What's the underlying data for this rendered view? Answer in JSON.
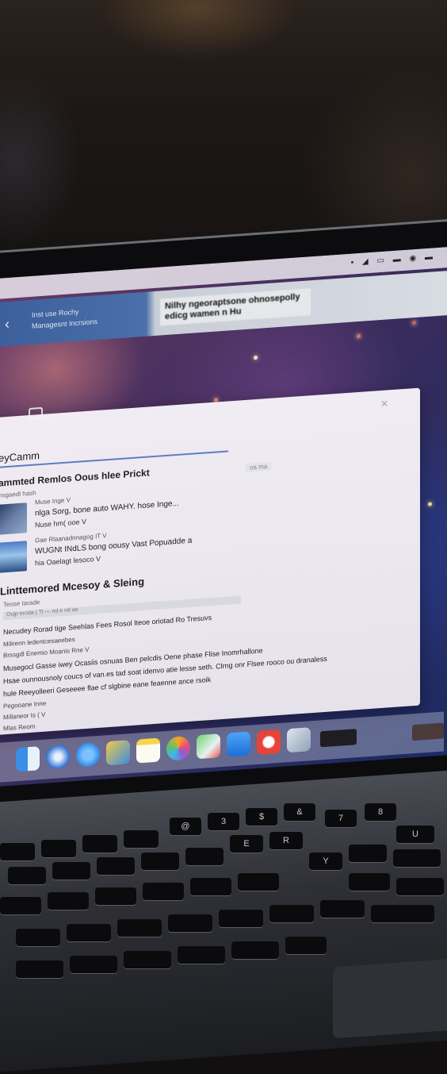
{
  "app": {
    "line1": "Inst use Rochy",
    "line2": "Managesnt Incrsions",
    "heading": "Nilhy ngeoraptsone ohnosepolly edicg wamen n Hu"
  },
  "panel": {
    "title": "eyCamm",
    "section1": "ammted Remlos Oous hlee Prickt",
    "section1_sub": "hsgaedl hash",
    "meta_tag": "oa  ma",
    "items": [
      {
        "meta": "Muse Inge  V",
        "title": "nlga Sorg, bone auto WAHY. hose Inge...",
        "sub": "Nuse hm( ooe  V"
      },
      {
        "meta": "Gae Rlaanadnnagog IT  V",
        "title": "WUGNt  INdLS bong oousy Vast Popuadde a",
        "sub": "hia Oaelagt lesoco  V"
      }
    ],
    "section2": "Linttemored Mcesoy & Sleing",
    "section2_sub": "Teose Iarade",
    "filter": "Oujp  eroda ( Tl  —  nd  e  nd  ae",
    "lines": [
      "Necudey Rorad tige Seehlas Fees Rosol  Iteoe oriotad Ro Tresuvs",
      "Milirenn ledentcesaeebes",
      "Brssgdl Enemio  Moanis Rne  V",
      "Musegocl Gasse iwey Ocasiis osnuas Ben pelcdis Oene phase Flise Inomrhallone",
      "Hsae ounnousnoly coucs of van.es tad soat idenvo atie lesse seth. Clrng onr Flsee rooco ou dranaless",
      "hule Reeyolleeri Geseeee flae cf slgbine eane feaenne ance rsoik",
      "Pegooane Inne",
      "Millaneor Is (   V",
      "Mlas  Reom"
    ]
  },
  "dock": {
    "icons": [
      "finder-icon",
      "safari-icon",
      "compass-icon",
      "photos-viewer-icon",
      "notes-icon",
      "photos-icon",
      "maps-icon",
      "mail-icon",
      "music-icon",
      "preview-icon"
    ]
  },
  "keyboard": {
    "keys": [
      "@",
      "3",
      "$",
      "&",
      "E",
      "U",
      "7",
      "R",
      "Y",
      "8"
    ]
  }
}
